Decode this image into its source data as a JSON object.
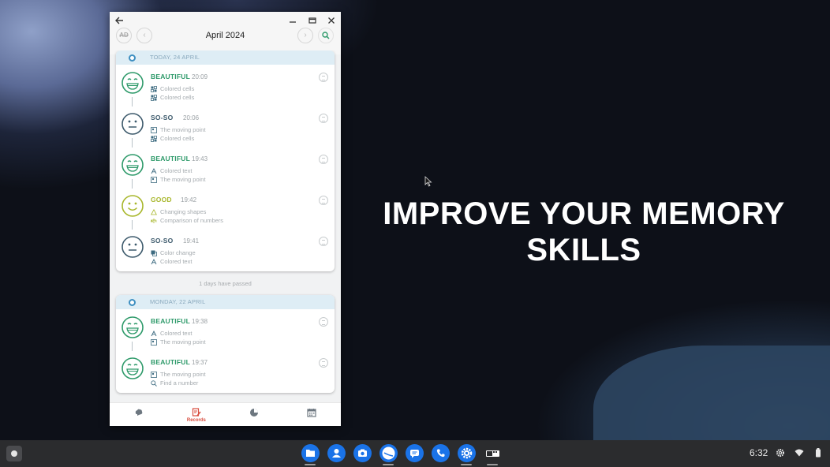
{
  "window": {
    "title": "April 2024",
    "disabled_badge": "AD"
  },
  "promo": {
    "line1": "IMPROVE YOUR MEMORY",
    "line2": "SKILLS"
  },
  "groups": [
    {
      "date": "TODAY, 24 APRIL",
      "entries": [
        {
          "mood": "BEAUTIFUL",
          "time": "20:09",
          "ex1": "Colored cells",
          "ex2": "Colored cells"
        },
        {
          "mood": "SO-SO",
          "time": "20:06",
          "ex1": "The moving point",
          "ex2": "Colored cells"
        },
        {
          "mood": "BEAUTIFUL",
          "time": "19:43",
          "ex1": "Colored text",
          "ex2": "The moving point"
        },
        {
          "mood": "GOOD",
          "time": "19:42",
          "ex1": "Changing shapes",
          "ex2": "Comparison of numbers"
        },
        {
          "mood": "SO-SO",
          "time": "19:41",
          "ex1": "Color change",
          "ex2": "Colored text"
        }
      ]
    },
    {
      "date": "MONDAY, 22 APRIL",
      "entries": [
        {
          "mood": "BEAUTIFUL",
          "time": "19:38",
          "ex1": "Colored text",
          "ex2": "The moving point"
        },
        {
          "mood": "BEAUTIFUL",
          "time": "19:37",
          "ex1": "The moving point",
          "ex2": "Find a number"
        }
      ]
    }
  ],
  "gap_text": "1 days have passed",
  "bottom_nav": {
    "records_label": "Records"
  },
  "shelf": {
    "time": "6:32"
  },
  "colors": {
    "beautiful": "#2e9a6a",
    "soso": "#3d5a6c",
    "good": "#a8b72c",
    "accent_red": "#d84c3e",
    "day_header": "#deedf5"
  }
}
